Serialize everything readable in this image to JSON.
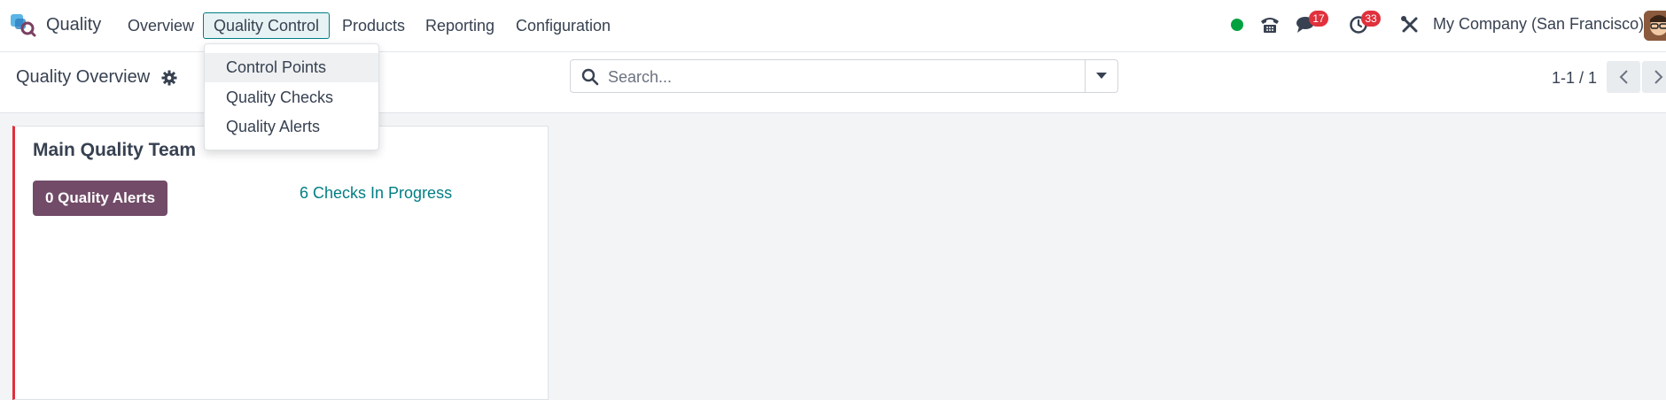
{
  "navbar": {
    "app_name": "Quality",
    "menu": [
      {
        "label": "Overview"
      },
      {
        "label": "Quality Control"
      },
      {
        "label": "Products"
      },
      {
        "label": "Reporting"
      },
      {
        "label": "Configuration"
      }
    ],
    "messages_count": "17",
    "activities_count": "33",
    "company": "My Company (San Francisco)",
    "status_color": "#00a240",
    "icons": [
      "status-dot-icon",
      "phone-icon",
      "chat-icon",
      "clock-icon",
      "tools-icon"
    ]
  },
  "dropdown": {
    "items": [
      {
        "label": "Control Points"
      },
      {
        "label": "Quality Checks"
      },
      {
        "label": "Quality Alerts"
      }
    ]
  },
  "control_panel": {
    "title": "Quality Overview",
    "search_placeholder": "Search...",
    "pager": "1-1 / 1"
  },
  "card": {
    "title": "Main Quality Team",
    "alerts_button": "0 Quality Alerts",
    "checks_link": "6 Checks In Progress",
    "accent_color": "#e0313c",
    "button_color": "#714b67"
  }
}
